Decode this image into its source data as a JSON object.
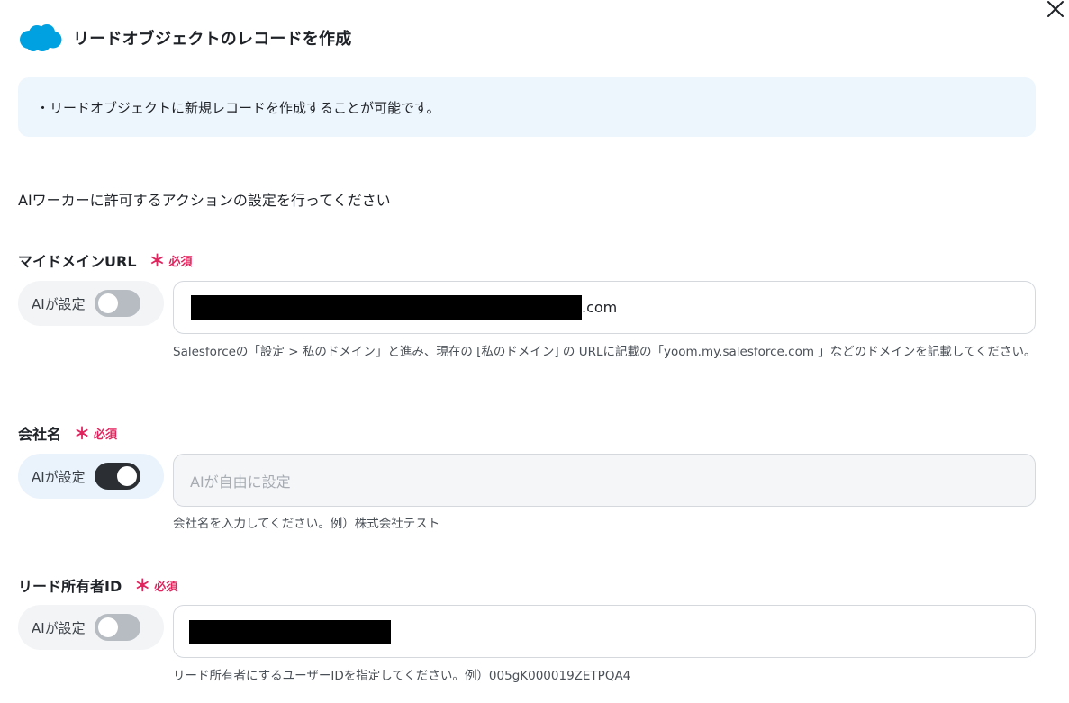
{
  "window": {
    "close_icon": "close-icon"
  },
  "header": {
    "logo_icon": "salesforce-cloud-icon",
    "logo_color": "#00a1e0",
    "title": "リードオブジェクトのレコードを作成"
  },
  "info": {
    "text": "・リードオブジェクトに新規レコードを作成することが可能です。"
  },
  "section": {
    "lead": "AIワーカーに許可するアクションの設定を行ってください"
  },
  "required_label": "必須",
  "fields": {
    "domain": {
      "label": "マイドメインURL",
      "ai_label": "AIが設定",
      "ai_enabled": false,
      "value_suffix": ".com",
      "help": "Salesforceの「設定 > 私のドメイン」と進み、現在の [私のドメイン] の URLに記載の「yoom.my.salesforce.com 」などのドメインを記載してください。"
    },
    "company": {
      "label": "会社名",
      "ai_label": "AIが設定",
      "ai_enabled": true,
      "placeholder": "AIが自由に設定",
      "help": "会社名を入力してください。例）株式会社テスト"
    },
    "owner": {
      "label": "リード所有者ID",
      "ai_label": "AIが設定",
      "ai_enabled": false,
      "help": "リード所有者にするユーザーIDを指定してください。例）005gK000019ZETPQA4"
    }
  },
  "colors": {
    "accent_required": "#e0245e",
    "info_bg": "#eef6fd",
    "toggle_on": "#2b2f33",
    "toggle_off": "#b7bcc2"
  }
}
